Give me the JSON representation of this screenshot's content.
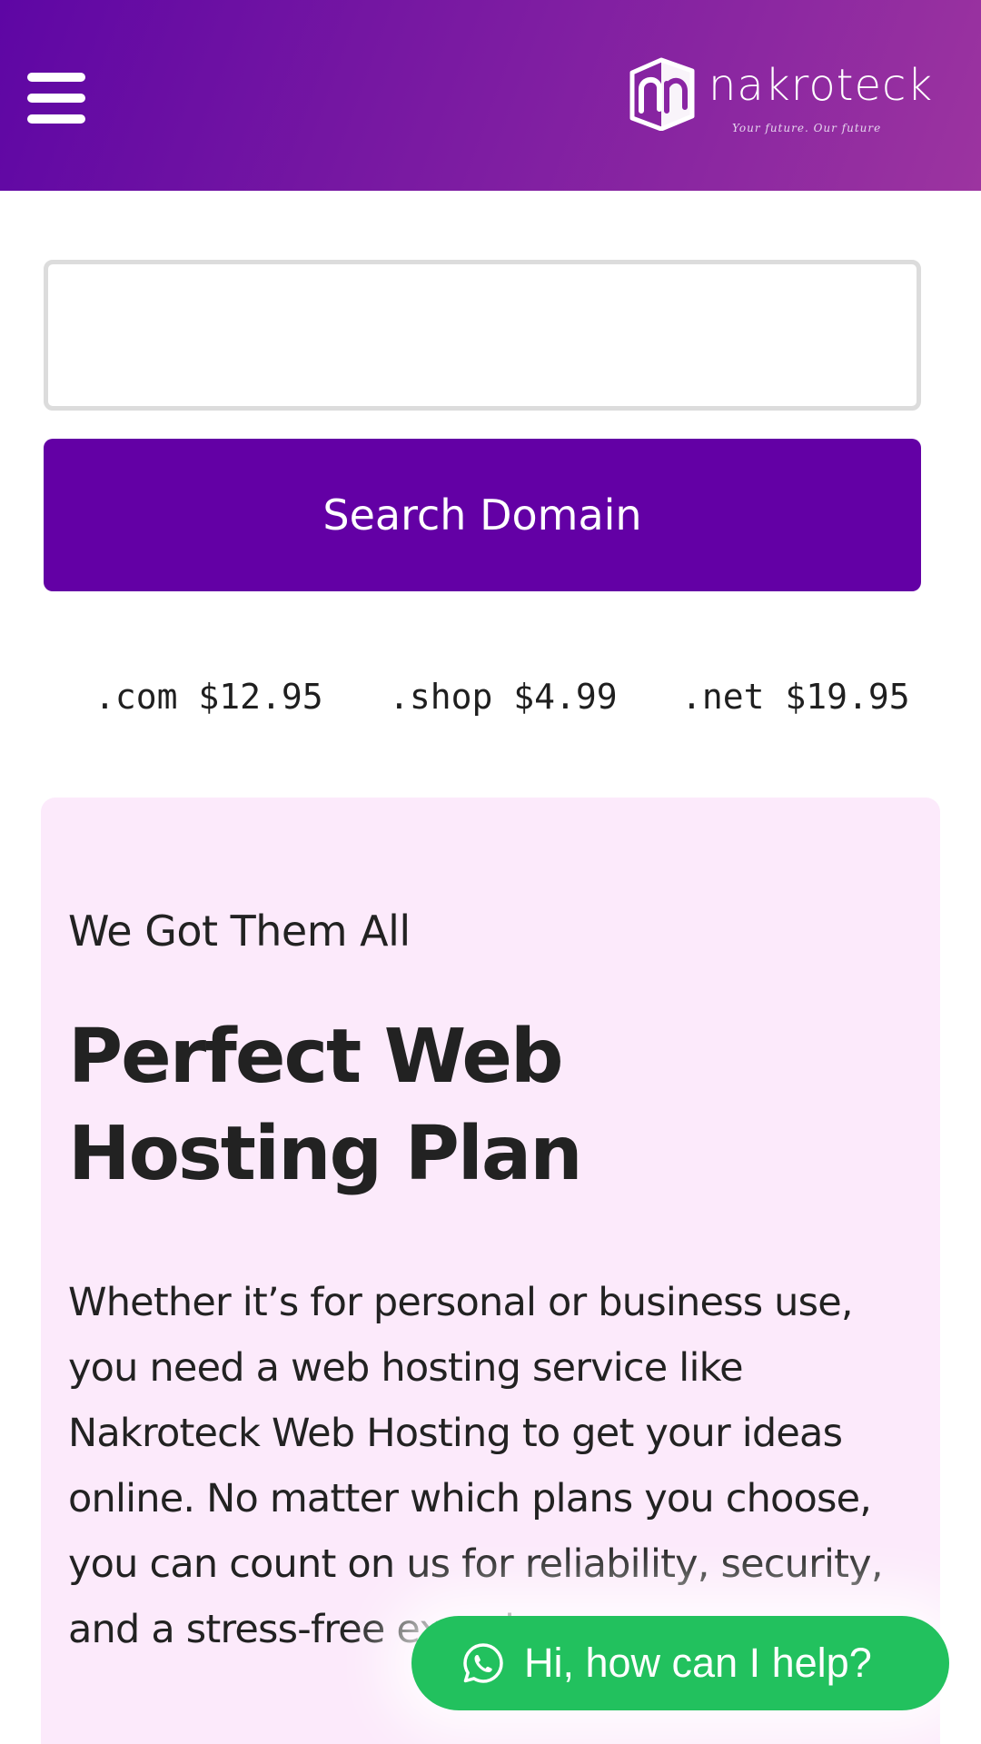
{
  "header": {
    "menu_icon": "hamburger-menu-icon",
    "logo": {
      "name": "nakroteck",
      "tagline": "Your future. Our future",
      "mark_icon": "cube-n-logo-icon"
    }
  },
  "search": {
    "input_value": "",
    "input_placeholder": "",
    "button_label": "Search Domain"
  },
  "domain_prices": [
    {
      "label": ".com $12.95"
    },
    {
      "label": ".shop $4.99"
    },
    {
      "label": ".net $19.95"
    }
  ],
  "hosting_card": {
    "eyebrow": "We Got Them All",
    "headline": "Perfect Web Hosting Plan",
    "body": "Whether it’s for personal or business use, you need a web hosting service like Nakroteck Web Hosting to get your ideas online. No matter which plans you choose, you can count on us for reliability, security, and a stress-free experience."
  },
  "chat": {
    "icon": "whatsapp-icon",
    "label": "Hi, how can I help?"
  },
  "colors": {
    "header_gradient_start": "#5e06a4",
    "header_gradient_end": "#9c34a0",
    "primary_button": "#6300a5",
    "card_background": "#fceafb",
    "chat_green": "#22c15e"
  }
}
